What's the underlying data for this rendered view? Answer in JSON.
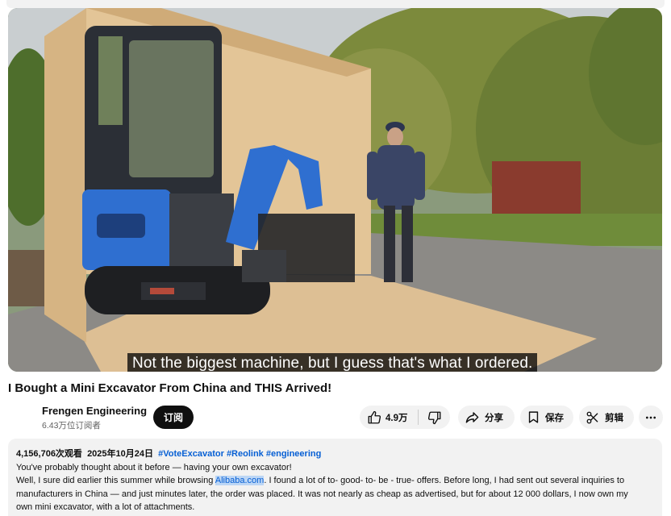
{
  "video": {
    "caption": "Not the biggest machine, but I guess that's what I ordered.",
    "title": "I Bought a Mini Excavator From China and THIS Arrived!"
  },
  "channel": {
    "name": "Frengen Engineering",
    "subscribers": "6.43万位订阅者",
    "subscribe_label": "订阅"
  },
  "actions": {
    "like_count": "4.9万",
    "share_label": "分享",
    "save_label": "保存",
    "clip_label": "剪辑"
  },
  "description": {
    "views": "4,156,706次观看",
    "date": "2025年10月24日",
    "hashtags": [
      "#VoteExcavator",
      "#Reolink",
      "#engineering"
    ],
    "line1": "You've probably thought about it before — having your own excavator!",
    "line2_before": "Well, I sure did earlier this summer while browsing ",
    "line2_highlight": "Alibaba.com",
    "line2_after": ". I found a lot of to- good- to- be - true- offers. Before long, I had sent out several inquiries to",
    "line3": "manufacturers in China — and just minutes later, the order was placed. It was not nearly as cheap as advertised, but for about 12 000 dollars, I now own my",
    "line4": "own mini excavator, with a lot of attachments."
  },
  "colors": {
    "link": "#065fd4",
    "highlight": "#bcd6f5",
    "subscribe_bg": "#0f0f0f",
    "chip_bg": "#f2f2f2",
    "excavator_blue": "#2f6fd0",
    "plywood": "#d9b88c"
  }
}
